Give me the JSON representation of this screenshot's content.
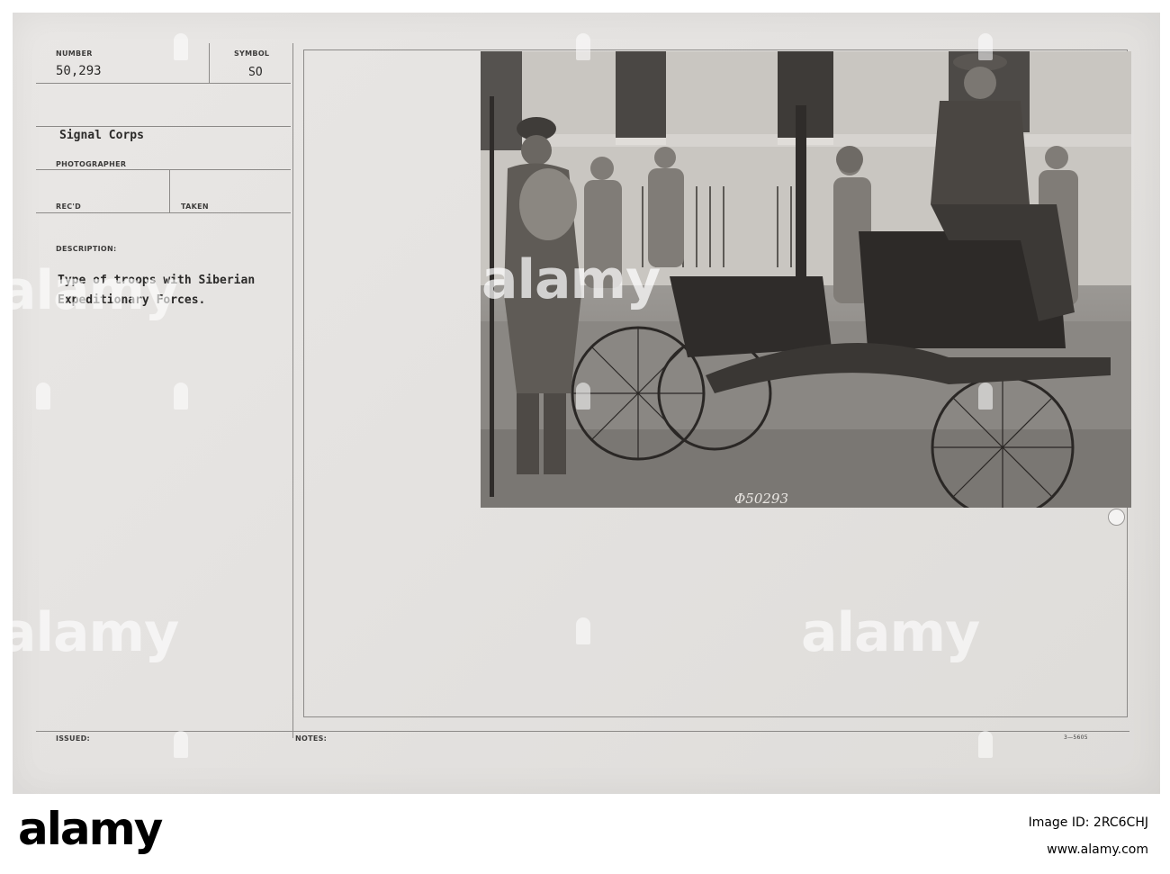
{
  "record": {
    "number_label": "NUMBER",
    "number_value": "50,293",
    "symbol_label": "SYMBOL",
    "symbol_value": "SO",
    "photographer_value": "Signal Corps",
    "photographer_label": "PHOTOGRAPHER",
    "recd_label": "REC'D",
    "taken_label": "TAKEN",
    "description_label": "DESCRIPTION:",
    "description_line1": "Type of troops with Siberian",
    "description_line2": "Expeditionary Forces.",
    "issued_label": "ISSUED:",
    "notes_label": "NOTES:",
    "form_code": "3—5605"
  },
  "photo": {
    "negative_number": "Φ50293"
  },
  "watermark": {
    "text": "alamy"
  },
  "footer": {
    "logo_text": "alamy",
    "image_id_label": "Image ID: 2RC6CHJ",
    "site_url": "www.alamy.com"
  }
}
